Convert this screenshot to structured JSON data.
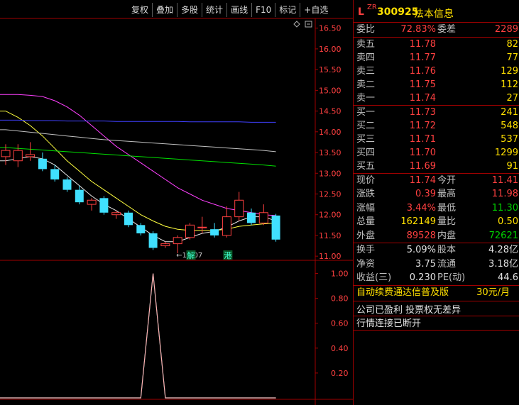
{
  "toolbar": {
    "items": [
      "复权",
      "叠加",
      "多股",
      "统计",
      "画线",
      "F10",
      "标记",
      "+自选"
    ]
  },
  "colors": {
    "up": "#ff4040",
    "down": "#40e0ff",
    "ma1": "#e8e8e8",
    "ma2": "#ffff40",
    "ma3": "#ff40ff",
    "ma4": "#00e000",
    "ma5": "#c0c0c0",
    "ma6": "#4040ff",
    "frame": "#a00000"
  },
  "chart_data": [
    {
      "type": "candlestick",
      "ylim": [
        10.9,
        16.7
      ],
      "ticks": [
        "16.50",
        "16.00",
        "15.50",
        "15.00",
        "14.50",
        "14.00",
        "13.50",
        "13.00",
        "12.50",
        "12.00",
        "11.50",
        "11.00"
      ],
      "tick_values": [
        16.5,
        16.0,
        15.5,
        15.0,
        14.5,
        14.0,
        13.5,
        13.0,
        12.5,
        12.0,
        11.5,
        11.0
      ],
      "candles": [
        {
          "o": 13.4,
          "h": 13.7,
          "l": 13.2,
          "c": 13.55
        },
        {
          "o": 13.3,
          "h": 13.7,
          "l": 13.15,
          "c": 13.55
        },
        {
          "o": 13.4,
          "h": 13.75,
          "l": 13.3,
          "c": 13.45
        },
        {
          "o": 13.35,
          "h": 13.5,
          "l": 13.05,
          "c": 13.1
        },
        {
          "o": 13.1,
          "h": 13.2,
          "l": 12.8,
          "c": 12.85
        },
        {
          "o": 12.85,
          "h": 12.9,
          "l": 12.55,
          "c": 12.6
        },
        {
          "o": 12.6,
          "h": 12.7,
          "l": 12.25,
          "c": 12.3
        },
        {
          "o": 12.25,
          "h": 12.4,
          "l": 12.1,
          "c": 12.35
        },
        {
          "o": 12.4,
          "h": 12.45,
          "l": 12.0,
          "c": 12.05
        },
        {
          "o": 12.0,
          "h": 12.1,
          "l": 11.9,
          "c": 12.05
        },
        {
          "o": 12.05,
          "h": 12.1,
          "l": 11.7,
          "c": 11.75
        },
        {
          "o": 11.75,
          "h": 11.8,
          "l": 11.5,
          "c": 11.55
        },
        {
          "o": 11.55,
          "h": 11.6,
          "l": 11.15,
          "c": 11.2
        },
        {
          "o": 11.25,
          "h": 11.35,
          "l": 11.2,
          "c": 11.3
        },
        {
          "o": 11.3,
          "h": 11.5,
          "l": 11.07,
          "c": 11.45
        },
        {
          "o": 11.45,
          "h": 11.8,
          "l": 11.4,
          "c": 11.75
        },
        {
          "o": 11.7,
          "h": 11.95,
          "l": 11.55,
          "c": 11.7
        },
        {
          "o": 11.65,
          "h": 11.8,
          "l": 11.45,
          "c": 11.5
        },
        {
          "o": 11.5,
          "h": 12.2,
          "l": 11.45,
          "c": 11.95
        },
        {
          "o": 11.95,
          "h": 12.55,
          "l": 11.85,
          "c": 12.35
        },
        {
          "o": 12.05,
          "h": 12.15,
          "l": 11.75,
          "c": 11.8
        },
        {
          "o": 11.8,
          "h": 12.25,
          "l": 11.75,
          "c": 12.05
        },
        {
          "o": 11.98,
          "h": 12.02,
          "l": 11.35,
          "c": 11.4
        }
      ],
      "ma_lines": [
        {
          "color_key": "ma1",
          "values": [
            13.3,
            13.35,
            13.4,
            13.35,
            13.2,
            12.95,
            12.7,
            12.45,
            12.25,
            12.1,
            11.9,
            11.7,
            11.5,
            11.35,
            11.35,
            11.45,
            11.55,
            11.6,
            11.7,
            11.85,
            11.95,
            11.95,
            11.85
          ]
        },
        {
          "color_key": "ma2",
          "values": [
            14.5,
            14.35,
            14.15,
            13.9,
            13.6,
            13.3,
            13.05,
            12.8,
            12.6,
            12.4,
            12.2,
            12.0,
            11.85,
            11.72,
            11.65,
            11.62,
            11.62,
            11.62,
            11.65,
            11.72,
            11.75,
            11.78,
            11.8
          ]
        },
        {
          "color_key": "ma3",
          "values": [
            14.9,
            14.9,
            14.88,
            14.85,
            14.75,
            14.6,
            14.4,
            14.15,
            13.9,
            13.65,
            13.45,
            13.25,
            13.05,
            12.85,
            12.65,
            12.5,
            12.35,
            12.25,
            12.15,
            12.1,
            12.05,
            12.0,
            11.98
          ]
        },
        {
          "color_key": "ma5",
          "values": [
            14.05,
            14.02,
            13.99,
            13.96,
            13.93,
            13.9,
            13.87,
            13.84,
            13.81,
            13.79,
            13.77,
            13.75,
            13.73,
            13.71,
            13.69,
            13.67,
            13.65,
            13.63,
            13.61,
            13.59,
            13.57,
            13.55,
            13.52
          ]
        },
        {
          "color_key": "ma4",
          "values": [
            13.62,
            13.6,
            13.58,
            13.56,
            13.54,
            13.52,
            13.5,
            13.48,
            13.46,
            13.44,
            13.42,
            13.4,
            13.38,
            13.36,
            13.34,
            13.32,
            13.3,
            13.28,
            13.26,
            13.24,
            13.22,
            13.2,
            13.17
          ]
        },
        {
          "color_key": "ma6",
          "values": [
            14.28,
            14.28,
            14.27,
            14.27,
            14.27,
            14.26,
            14.26,
            14.26,
            14.26,
            14.25,
            14.25,
            14.25,
            14.25,
            14.25,
            14.25,
            14.24,
            14.24,
            14.24,
            14.24,
            14.24,
            14.23,
            14.23,
            14.23
          ]
        }
      ],
      "low_marker": {
        "index": 14,
        "label": "←11.07"
      },
      "event_markers": [
        {
          "index": 15,
          "label": "解"
        },
        {
          "index": 18,
          "label": "港"
        }
      ]
    },
    {
      "type": "line",
      "ylim": [
        0,
        1.1
      ],
      "ticks": [
        "1.00",
        "0.80",
        "0.60",
        "0.40",
        "0.20"
      ],
      "tick_values": [
        1.0,
        0.8,
        0.6,
        0.4,
        0.2
      ],
      "values": [
        0,
        0,
        0,
        0,
        0,
        0,
        0,
        0,
        0,
        0,
        0,
        0,
        1.0,
        0,
        0,
        0,
        0,
        0,
        0,
        0,
        0,
        0,
        0
      ]
    }
  ],
  "quote": {
    "flag_l": "L",
    "flag_zr": "ZR",
    "code": "300925",
    "name": "法本信息",
    "weibi_label": "委比",
    "weibi_value": "72.83%",
    "weicha_label": "委差",
    "weicha_value": "2289",
    "asks": [
      {
        "label": "卖五",
        "price": "11.78",
        "vol": "82"
      },
      {
        "label": "卖四",
        "price": "11.77",
        "vol": "77"
      },
      {
        "label": "卖三",
        "price": "11.76",
        "vol": "129"
      },
      {
        "label": "卖二",
        "price": "11.75",
        "vol": "112"
      },
      {
        "label": "卖一",
        "price": "11.74",
        "vol": "27"
      }
    ],
    "bids": [
      {
        "label": "买一",
        "price": "11.73",
        "vol": "241"
      },
      {
        "label": "买二",
        "price": "11.72",
        "vol": "548"
      },
      {
        "label": "买三",
        "price": "11.71",
        "vol": "537"
      },
      {
        "label": "买四",
        "price": "11.70",
        "vol": "1299"
      },
      {
        "label": "买五",
        "price": "11.69",
        "vol": "91"
      }
    ],
    "stats": [
      {
        "l1": "现价",
        "v1": "11.74",
        "c1": "red",
        "l2": "今开",
        "v2": "11.41",
        "c2": "red"
      },
      {
        "l1": "涨跌",
        "v1": "0.39",
        "c1": "red",
        "l2": "最高",
        "v2": "11.98",
        "c2": "red"
      },
      {
        "l1": "涨幅",
        "v1": "3.44%",
        "c1": "red",
        "l2": "最低",
        "v2": "11.30",
        "c2": "green"
      },
      {
        "l1": "总量",
        "v1": "162149",
        "c1": "yellow",
        "l2": "量比",
        "v2": "0.50",
        "c2": "yellow"
      },
      {
        "l1": "外盘",
        "v1": "89528",
        "c1": "red",
        "l2": "内盘",
        "v2": "72621",
        "c2": "green"
      }
    ],
    "fund": [
      {
        "l1": "换手",
        "v1": "5.09%",
        "l2": "股本",
        "v2": "4.28亿"
      },
      {
        "l1": "净资",
        "v1": "3.75",
        "l2": "流通",
        "v2": "3.18亿"
      },
      {
        "l1": "收益(三)",
        "v1": "0.230",
        "l2": "PE(动)",
        "v2": "44.6"
      }
    ],
    "promo_text": "自动续费通达信普及版",
    "promo_price": "30元/月",
    "msg1": "公司已盈利 投票权无差异",
    "msg2": "行情连接已断开"
  }
}
